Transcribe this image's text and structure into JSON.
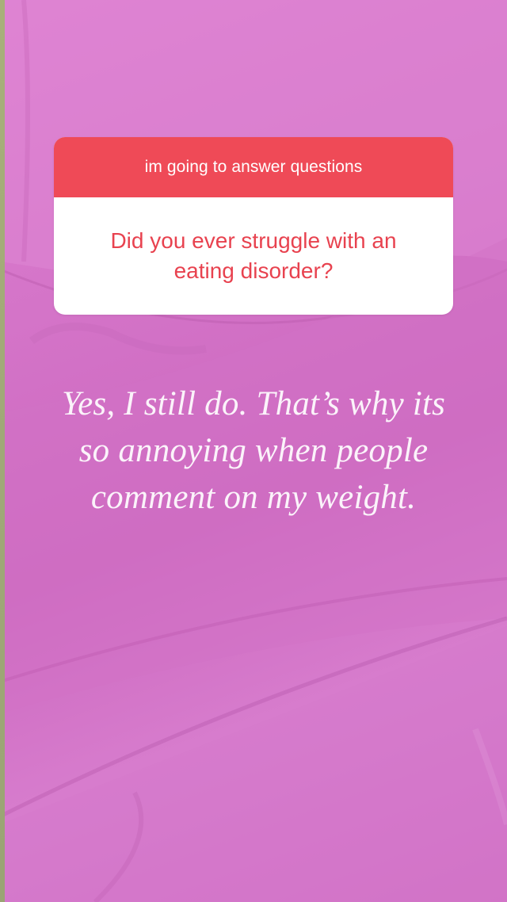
{
  "story": {
    "background": {
      "description_icon": "pink-bedsheet-photo",
      "accent": "#d474c8"
    },
    "question_sticker": {
      "header": "im going to answer questions",
      "question": "Did you ever struggle with an eating disorder?",
      "header_color": "#ef4a57",
      "question_color": "#e8424f"
    },
    "answer": {
      "lines": [
        "Yes, I still do. That’s why its",
        "so annoying when people",
        "comment on my weight."
      ]
    }
  }
}
